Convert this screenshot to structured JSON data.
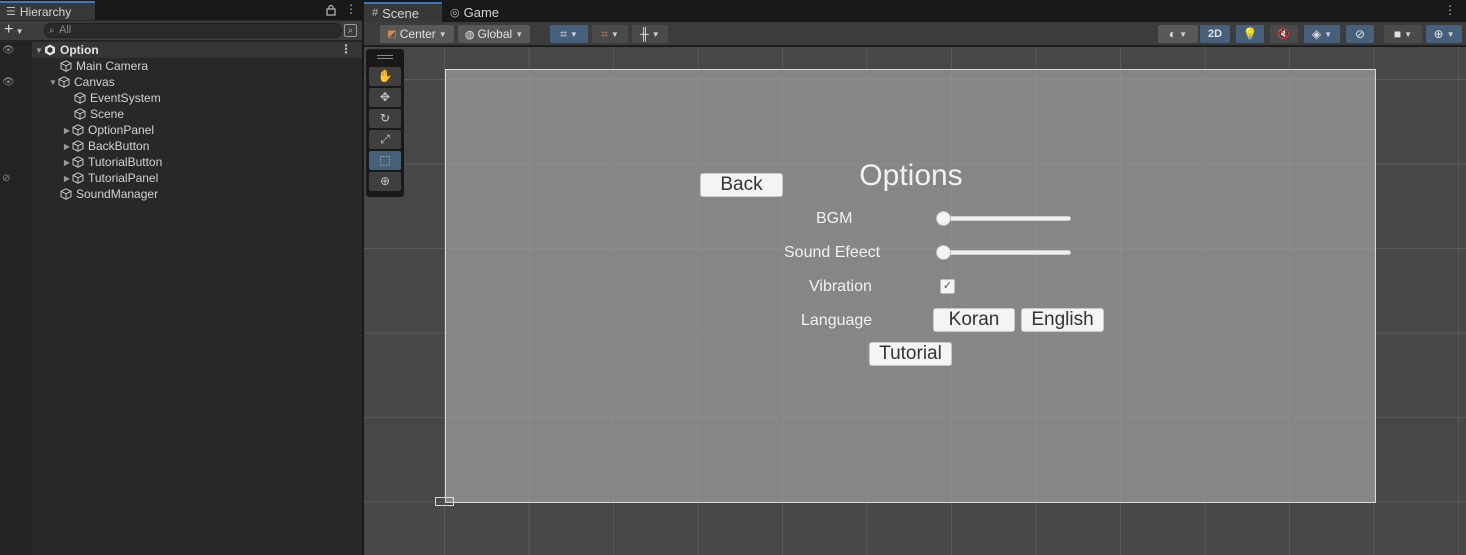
{
  "hierarchy": {
    "tab_label": "Hierarchy",
    "search_placeholder": "All",
    "add_label": "+",
    "rows": {
      "option": "Option",
      "main_camera": "Main Camera",
      "canvas": "Canvas",
      "event_system": "EventSystem",
      "scene": "Scene",
      "option_panel": "OptionPanel",
      "back_button": "BackButton",
      "tutorial_button": "TutorialButton",
      "tutorial_panel": "TutorialPanel",
      "sound_manager": "SoundManager"
    }
  },
  "scene_view": {
    "tabs": {
      "scene": "Scene",
      "game": "Game"
    },
    "toolbar": {
      "pivot": "Center",
      "space": "Global",
      "mode_2d": "2D"
    }
  },
  "game_ui": {
    "title": "Options",
    "back_label": "Back",
    "bgm_label": "BGM",
    "sound_effect_label": "Sound Efeect",
    "vibration_label": "Vibration",
    "language_label": "Language",
    "korean_label": "Koran",
    "english_label": "English",
    "tutorial_label": "Tutorial",
    "bgm_value": 0.0,
    "sound_effect_value": 0.0,
    "vibration_checked": true
  },
  "colors": {
    "accent_blue": "#3a79bb",
    "active_tool": "#46607c",
    "panel_bg": "#282828",
    "viewport_bg": "#474747"
  },
  "icons": {
    "hierarchy_tab": "list-icon",
    "lock": "lock-icon",
    "menu": "kebab-menu-icon",
    "scene_tab": "grid-icon",
    "game_tab": "gamepad-icon",
    "object": "cube-icon",
    "scene_asset": "unity-logo-icon"
  }
}
